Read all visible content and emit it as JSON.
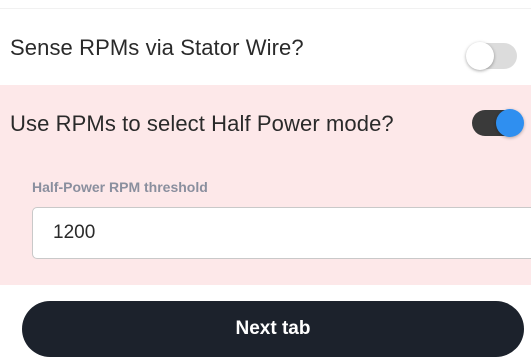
{
  "settings": {
    "sense_rpm": {
      "label": "Sense RPMs via Stator Wire?",
      "enabled": false
    },
    "half_power_mode": {
      "label": "Use RPMs to select Half Power mode?",
      "enabled": true,
      "highlight_color": "#fde8e9"
    },
    "threshold": {
      "label": "Half-Power RPM threshold",
      "value": "1200"
    }
  },
  "footer": {
    "next_label": "Next tab"
  },
  "colors": {
    "toggle_on_track": "#3a3a3a",
    "toggle_on_knob": "#2f8ff0",
    "toggle_off_track": "#dcdcdc",
    "button_background": "#1c222c"
  }
}
